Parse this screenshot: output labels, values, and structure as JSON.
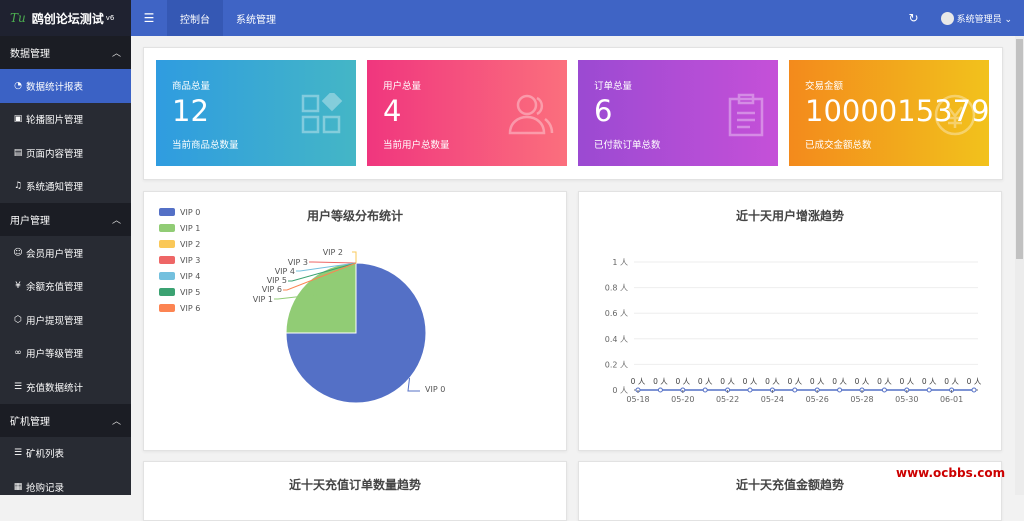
{
  "app": {
    "logo_mark": "Tu",
    "title": "鸥创论坛测试",
    "version": "v6"
  },
  "sidebar": {
    "groups": [
      {
        "label": "数据管理",
        "items": [
          {
            "icon": "gauge-icon",
            "label": "数据统计报表",
            "active": true
          },
          {
            "icon": "image-icon",
            "label": "轮播图片管理"
          },
          {
            "icon": "page-icon",
            "label": "页面内容管理"
          },
          {
            "icon": "bell-icon",
            "label": "系统通知管理"
          }
        ]
      },
      {
        "label": "用户管理",
        "items": [
          {
            "icon": "user-icon",
            "label": "会员用户管理"
          },
          {
            "icon": "yen-icon",
            "label": "余额充值管理"
          },
          {
            "icon": "cube-icon",
            "label": "用户提现管理"
          },
          {
            "icon": "infinity-icon",
            "label": "用户等级管理"
          },
          {
            "icon": "list-icon",
            "label": "充值数据统计"
          }
        ]
      },
      {
        "label": "矿机管理",
        "items": [
          {
            "icon": "list-icon",
            "label": "矿机列表"
          },
          {
            "icon": "calendar-icon",
            "label": "抢购记录"
          }
        ]
      }
    ]
  },
  "topbar": {
    "menu_icon": "☰",
    "tabs": [
      "控制台",
      "系统管理"
    ],
    "active_tab": 0,
    "refresh_icon": "↻",
    "user": "系统管理员"
  },
  "cards": [
    {
      "label": "商品总量",
      "value": "12",
      "sub": "当前商品总数量",
      "color1": "#2f9ce0",
      "color2": "#44b6c6",
      "icon": "grid-icon"
    },
    {
      "label": "用户总量",
      "value": "4",
      "sub": "当前用户总数量",
      "color1": "#f0367e",
      "color2": "#fb6f7d",
      "icon": "users-icon"
    },
    {
      "label": "订单总量",
      "value": "6",
      "sub": "已付款订单总数",
      "color1": "#9b4ad2",
      "color2": "#c550d8",
      "icon": "clipboard-icon"
    },
    {
      "label": "交易金额",
      "value": "1000015379",
      "sub": "已成交金额总数",
      "color1": "#f38a1c",
      "color2": "#f2c21c",
      "icon": "coin-icon"
    }
  ],
  "charts": {
    "pie": {
      "title": "用户等级分布统计"
    },
    "line": {
      "title": "近十天用户增涨趋势"
    },
    "bottom_left": {
      "title": "近十天充值订单数量趋势"
    },
    "bottom_right": {
      "title": "近十天充值金额趋势"
    }
  },
  "chart_data": [
    {
      "type": "pie",
      "title": "用户等级分布统计",
      "slices": [
        {
          "name": "VIP 0",
          "value": 3,
          "color": "#5470c6"
        },
        {
          "name": "VIP 1",
          "value": 1,
          "color": "#91cc75"
        },
        {
          "name": "VIP 2",
          "value": 0,
          "color": "#fac858"
        },
        {
          "name": "VIP 3",
          "value": 0,
          "color": "#ee6666"
        },
        {
          "name": "VIP 4",
          "value": 0,
          "color": "#73c0de"
        },
        {
          "name": "VIP 5",
          "value": 0,
          "color": "#3ba272"
        },
        {
          "name": "VIP 6",
          "value": 0,
          "color": "#fc8452"
        }
      ],
      "legend": "top-left"
    },
    {
      "type": "line",
      "title": "近十天用户增涨趋势",
      "x": [
        "05-18",
        "05-19",
        "05-20",
        "05-21",
        "05-22",
        "05-23",
        "05-24",
        "05-25",
        "05-26",
        "05-27",
        "05-28",
        "05-29",
        "05-30",
        "05-31",
        "06-01",
        "06-02"
      ],
      "x_tick_labels": [
        "05-18",
        "05-20",
        "05-22",
        "05-24",
        "05-26",
        "05-28",
        "05-30",
        "06-01"
      ],
      "values": [
        0,
        0,
        0,
        0,
        0,
        0,
        0,
        0,
        0,
        0,
        0,
        0,
        0,
        0,
        0,
        0
      ],
      "point_label": "0 人",
      "y_ticks": [
        "0 人",
        "0.2 人",
        "0.4 人",
        "0.6 人",
        "0.8 人",
        "1 人"
      ],
      "ylim": [
        0,
        1
      ],
      "color": "#5470c6",
      "grid": true
    }
  ],
  "watermark": "www.ocbbs.com"
}
